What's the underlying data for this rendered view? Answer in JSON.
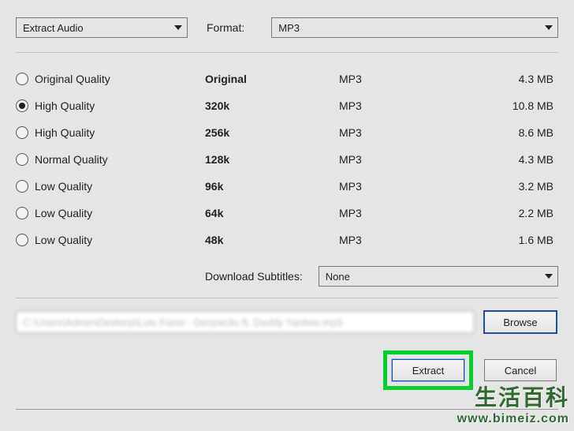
{
  "top": {
    "action_value": "Extract Audio",
    "format_label": "Format:",
    "format_value": "MP3"
  },
  "quality_options": [
    {
      "label": "Original Quality",
      "bitrate": "Original",
      "codec": "MP3",
      "size": "4.3 MB",
      "selected": false
    },
    {
      "label": "High Quality",
      "bitrate": "320k",
      "codec": "MP3",
      "size": "10.8 MB",
      "selected": true
    },
    {
      "label": "High Quality",
      "bitrate": "256k",
      "codec": "MP3",
      "size": "8.6 MB",
      "selected": false
    },
    {
      "label": "Normal Quality",
      "bitrate": "128k",
      "codec": "MP3",
      "size": "4.3 MB",
      "selected": false
    },
    {
      "label": "Low Quality",
      "bitrate": "96k",
      "codec": "MP3",
      "size": "3.2 MB",
      "selected": false
    },
    {
      "label": "Low Quality",
      "bitrate": "64k",
      "codec": "MP3",
      "size": "2.2 MB",
      "selected": false
    },
    {
      "label": "Low Quality",
      "bitrate": "48k",
      "codec": "MP3",
      "size": "1.6 MB",
      "selected": false
    }
  ],
  "subtitles": {
    "label": "Download Subtitles:",
    "value": "None"
  },
  "path": {
    "value": "C:\\Users\\Admin\\Desktop\\Luis Fonsi - Despacito ft. Daddy Yankee.mp3"
  },
  "buttons": {
    "browse": "Browse",
    "extract": "Extract",
    "cancel": "Cancel"
  },
  "watermark": {
    "line1": "生活百科",
    "line2": "www.bimeiz.com"
  }
}
